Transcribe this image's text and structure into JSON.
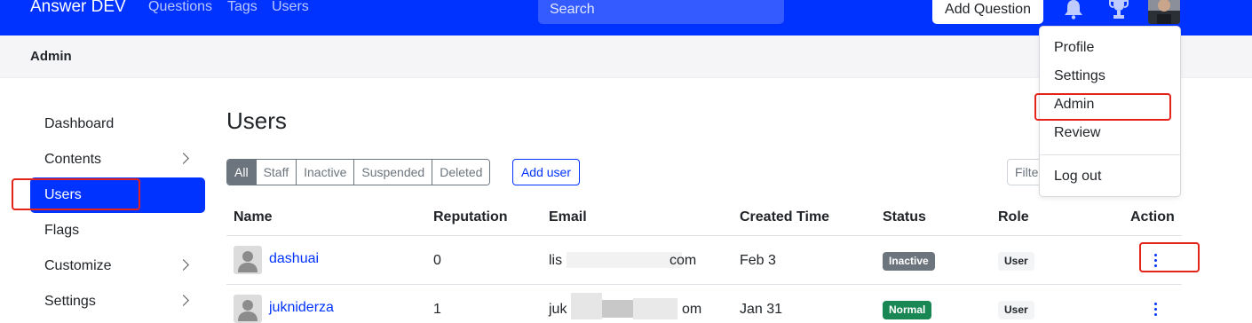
{
  "navbar": {
    "brand": "Answer DEV",
    "links": [
      "Questions",
      "Tags",
      "Users"
    ],
    "search_placeholder": "Search",
    "add_question": "Add Question",
    "colors": {
      "primary": "#0033ff"
    }
  },
  "subheader": {
    "title": "Admin"
  },
  "sidebar": {
    "items": [
      {
        "label": "Dashboard"
      },
      {
        "label": "Contents"
      },
      {
        "label": "Users"
      },
      {
        "label": "Flags"
      },
      {
        "label": "Customize"
      },
      {
        "label": "Settings"
      }
    ]
  },
  "main": {
    "title": "Users",
    "filters": [
      "All",
      "Staff",
      "Inactive",
      "Suspended",
      "Deleted"
    ],
    "add_user": "Add user",
    "filter_placeholder": "Filte",
    "columns": [
      "Name",
      "Reputation",
      "Email",
      "Created Time",
      "Status",
      "Role",
      "Action"
    ],
    "rows": [
      {
        "name": "dashuai",
        "reputation": "0",
        "email_start": "lis",
        "email_end": "com",
        "created": "Feb 3",
        "status": "Inactive",
        "role": "User"
      },
      {
        "name": "jukniderza",
        "reputation": "1",
        "email_start": "juk",
        "email_end": "om",
        "created": "Jan 31",
        "status": "Normal",
        "role": "User"
      }
    ]
  },
  "dropdown": {
    "items": [
      "Profile",
      "Settings",
      "Admin",
      "Review"
    ],
    "logout": "Log out"
  },
  "annotations": {
    "highlight_color": "#e7221b"
  }
}
